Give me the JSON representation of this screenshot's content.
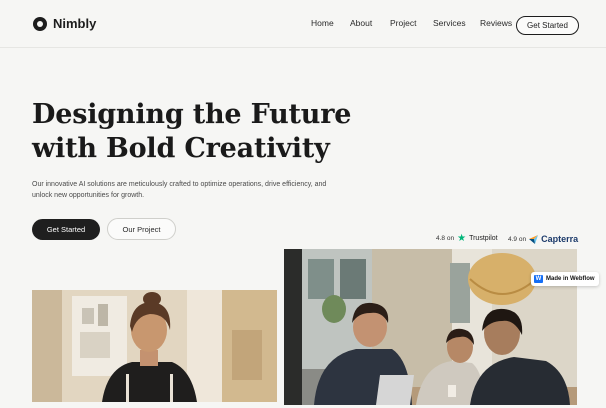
{
  "brand": {
    "name": "Nimbly",
    "logo_icon": "ring-logo-icon"
  },
  "nav": {
    "items": [
      "Home",
      "About",
      "Project",
      "Services",
      "Reviews"
    ],
    "cta": "Get Started"
  },
  "hero": {
    "title_line1": "Designing the Future",
    "title_line2": "with Bold Creativity",
    "subtitle": "Our innovative AI solutions are meticulously crafted to optimize operations, drive efficiency, and unlock new opportunities for growth.",
    "primary_button": "Get Started",
    "secondary_button": "Our Project"
  },
  "ratings": [
    {
      "score": "4.8 on",
      "platform": "Trustpilot",
      "icon": "star-icon",
      "color": "#00b67a"
    },
    {
      "score": "4.9 on",
      "platform": "Capterra",
      "icon": "capterra-icon",
      "color": "#1d3b6b"
    }
  ],
  "badge": {
    "label": "Made in Webflow",
    "icon": "webflow-icon",
    "color": "#146ef5"
  },
  "colors": {
    "background": "#f6f6f4",
    "primary_button": "#1f1f1f",
    "text": "#1d1d1d"
  }
}
